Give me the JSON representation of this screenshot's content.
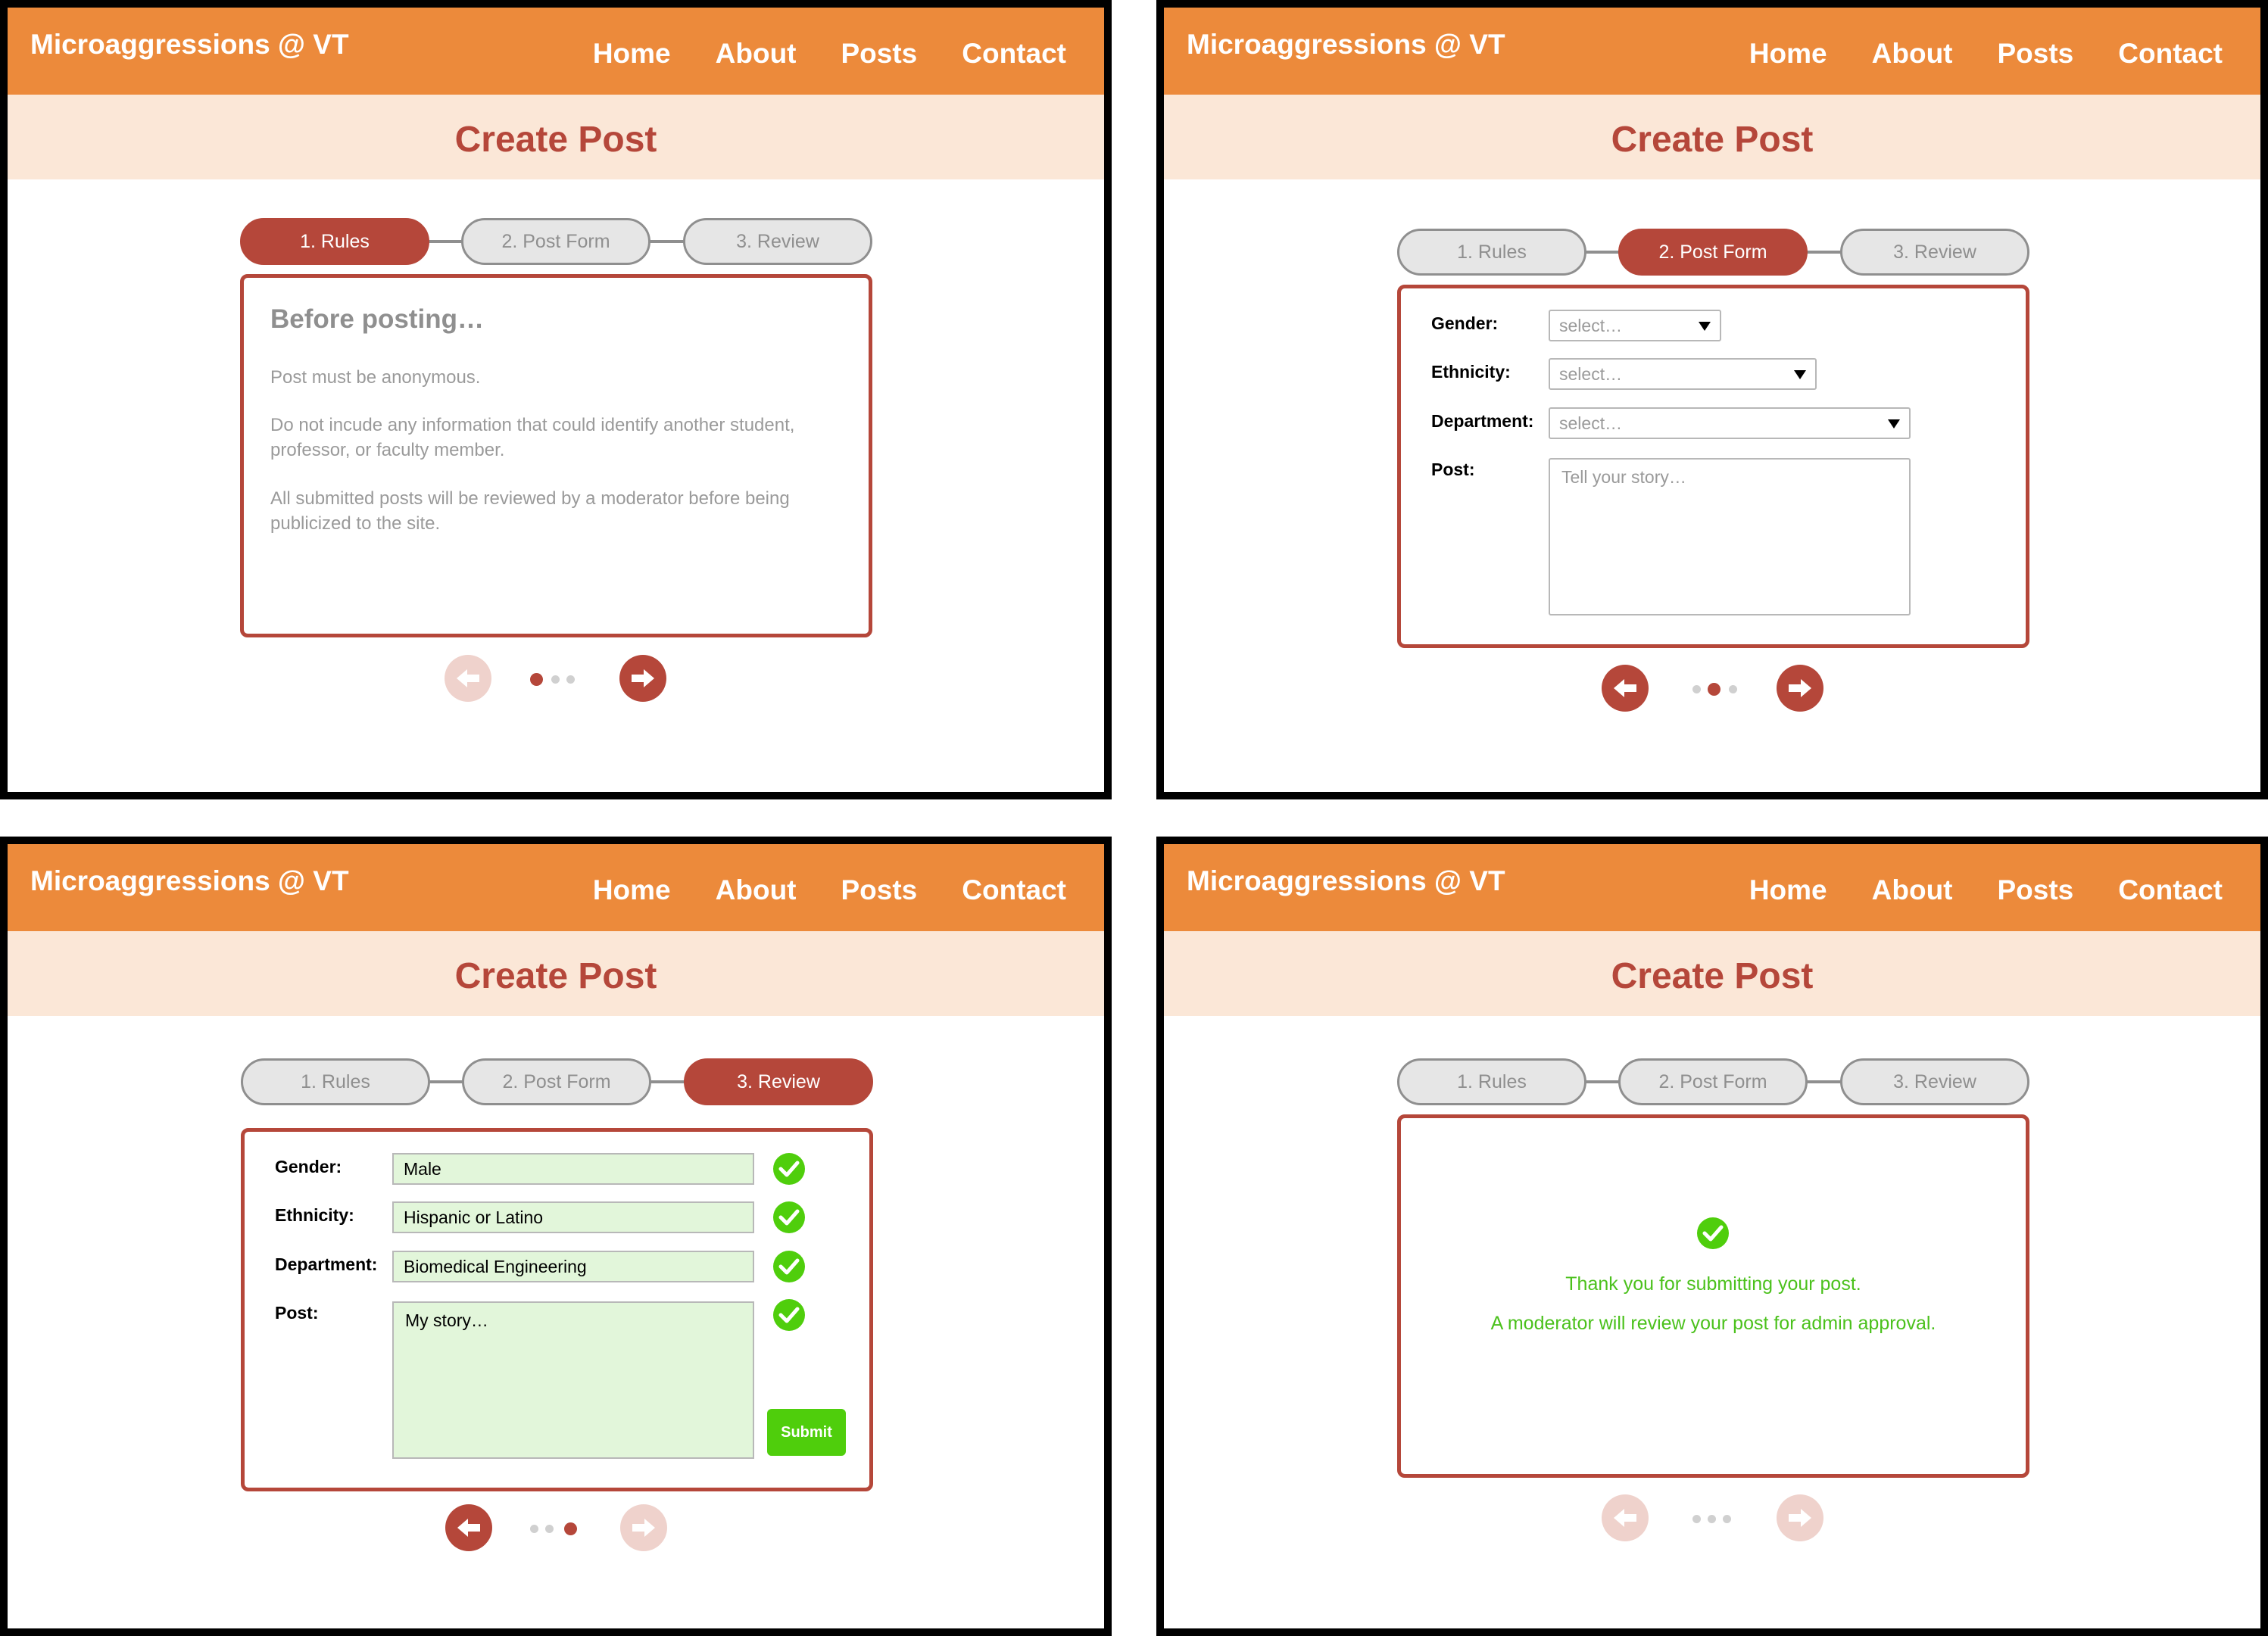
{
  "site": {
    "brand": "Microaggressions @ VT",
    "nav": [
      "Home",
      "About",
      "Posts",
      "Contact"
    ],
    "page_title": "Create Post"
  },
  "steps": [
    "1. Rules",
    "2. Post Form",
    "3. Review"
  ],
  "colors": {
    "nav_bg": "#ec8a3b",
    "subheader_bg": "#fbe7d7",
    "accent": "#b5473a",
    "success": "#4fce0c",
    "review_field_bg": "#e2f6da"
  },
  "screens": {
    "rules": {
      "active_step": 1,
      "heading": "Before posting…",
      "rules": [
        "Post must be anonymous.",
        "Do not incude any information that could identify another student, professor, or faculty member.",
        "All submitted posts will be reviewed by a moderator before being publicized to the site."
      ]
    },
    "form": {
      "active_step": 2,
      "labels": {
        "gender": "Gender:",
        "ethnicity": "Ethnicity:",
        "department": "Department:",
        "post": "Post:"
      },
      "select_placeholder": "select…",
      "post_placeholder": "Tell your story…"
    },
    "review": {
      "active_step": 3,
      "labels": {
        "gender": "Gender:",
        "ethnicity": "Ethnicity:",
        "department": "Department:",
        "post": "Post:"
      },
      "values": {
        "gender": "Male",
        "ethnicity": "Hispanic or Latino",
        "department": "Biomedical Engineering",
        "post": "My story…"
      },
      "submit_label": "Submit"
    },
    "confirmation": {
      "active_step": 0,
      "line1": "Thank you for submitting your post.",
      "line2": "A moderator will review your post for admin approval."
    }
  },
  "icons": {
    "prev": "arrow-left-icon",
    "next": "arrow-right-icon",
    "success": "check-circle-icon"
  }
}
